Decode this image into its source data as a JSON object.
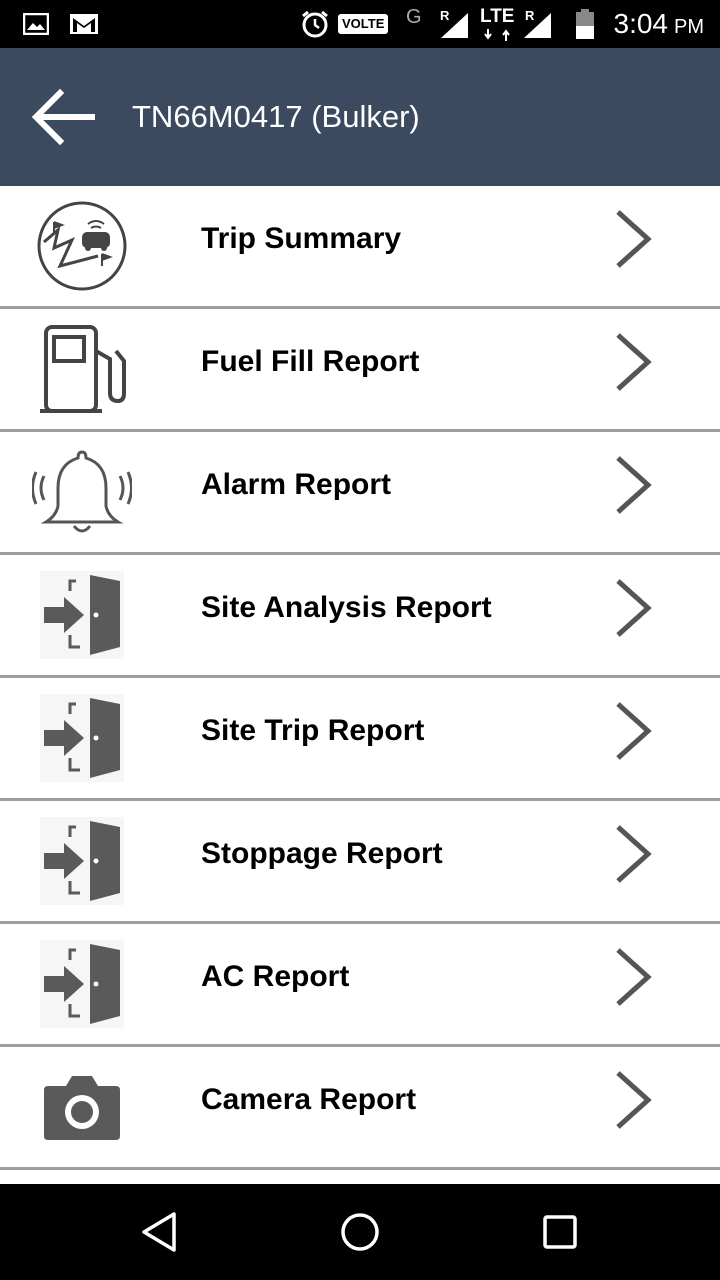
{
  "status_bar": {
    "time": "3:04",
    "ampm": "PM",
    "volte": "VOLTE",
    "network_g": "G",
    "roaming_1": "R",
    "lte": "LTE",
    "roaming_2": "R"
  },
  "app_bar": {
    "title": "TN66M0417 (Bulker)"
  },
  "menu": {
    "items": [
      {
        "label": "Trip Summary",
        "icon": "trip-summary-icon"
      },
      {
        "label": "Fuel Fill Report",
        "icon": "fuel-pump-icon"
      },
      {
        "label": "Alarm Report",
        "icon": "alarm-bell-icon"
      },
      {
        "label": "Site Analysis Report",
        "icon": "door-enter-icon"
      },
      {
        "label": "Site Trip Report",
        "icon": "door-enter-icon"
      },
      {
        "label": "Stoppage Report",
        "icon": "door-enter-icon"
      },
      {
        "label": "AC Report",
        "icon": "door-enter-icon"
      },
      {
        "label": "Camera Report",
        "icon": "camera-icon"
      }
    ]
  },
  "colors": {
    "app_bar": "#3c4a5f",
    "divider": "#9e9e9e",
    "icon_gray": "#5a5a5a"
  }
}
